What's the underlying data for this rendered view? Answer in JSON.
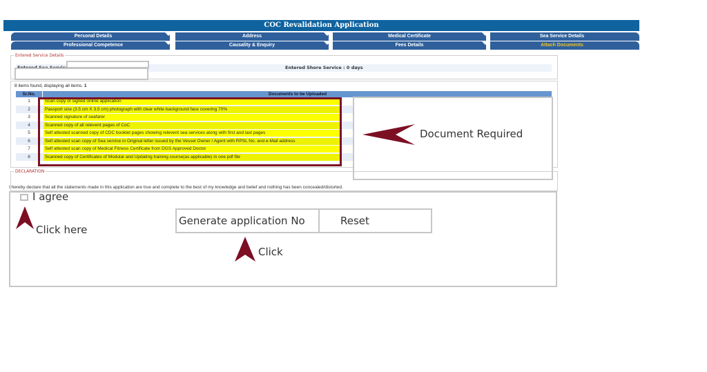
{
  "header": {
    "title": "COC Revalidation Application"
  },
  "tabs": {
    "row1": [
      {
        "label": "Personal Details",
        "active": false
      },
      {
        "label": "Address",
        "active": false
      },
      {
        "label": "Medical Certificate",
        "active": false
      },
      {
        "label": "Sea Service Details",
        "active": false
      }
    ],
    "row2": [
      {
        "label": "Professional Competence",
        "active": false
      },
      {
        "label": "Causality & Enquiry",
        "active": false
      },
      {
        "label": "Fees Details",
        "active": false
      },
      {
        "label": "Attach Documents",
        "active": true
      }
    ]
  },
  "service_details": {
    "legend": "Entered Service Details",
    "sea_service_label": "Entered Sea Service :",
    "shore_service_label": "Entered Shore Service : 0 days"
  },
  "documents": {
    "items_found": "8 items found, displaying all items.",
    "page": "1",
    "columns": [
      "Sr.No.",
      "Documents to be Uploaded"
    ],
    "rows": [
      {
        "sr": "1",
        "doc": "Scan copy of signed online application"
      },
      {
        "sr": "2",
        "doc": "Passport size (3.5 cm X 3.5 cm) photograph with clear white background face covering 70%"
      },
      {
        "sr": "3",
        "doc": "Scanned signature of seafarer"
      },
      {
        "sr": "4",
        "doc": "Scanned copy of all relevent pages of CoC"
      },
      {
        "sr": "5",
        "doc": "Self attested scanned copy of CDC booklet pages showing relevent sea services along with first and last pages"
      },
      {
        "sr": "6",
        "doc": "Self attested scan copy of Sea service in Original letter issued by the Vessel Owner / Agent with RPSL No. and e-Mail address"
      },
      {
        "sr": "7",
        "doc": "Self attested scan copy of Medical Fitness Certificate from DGS Approved Doctor"
      },
      {
        "sr": "8",
        "doc": "Scanned copy of Certificates of Modular and Updating training course(as applicable) in one pdf file"
      }
    ]
  },
  "annotations": {
    "document_required": "Document Required",
    "click_here": "Click here",
    "click": "Click",
    "arrow_color": "#7c0f24"
  },
  "declaration": {
    "legend": "DECLARATION",
    "text": "I hereby declare that all the statements made in this application are true and complete to the best of my knowledge and belief and nothing has been concealed/distorted.",
    "agree_label": "I agree",
    "agree_checked": false
  },
  "actions": {
    "generate_label": "Generate application No",
    "reset_label": "Reset"
  },
  "colors": {
    "header_bg": "#0f639f",
    "tab_bg": "#2f609c",
    "active_tab_text": "#f3c321",
    "highlight_yellow": "#fbff00"
  }
}
